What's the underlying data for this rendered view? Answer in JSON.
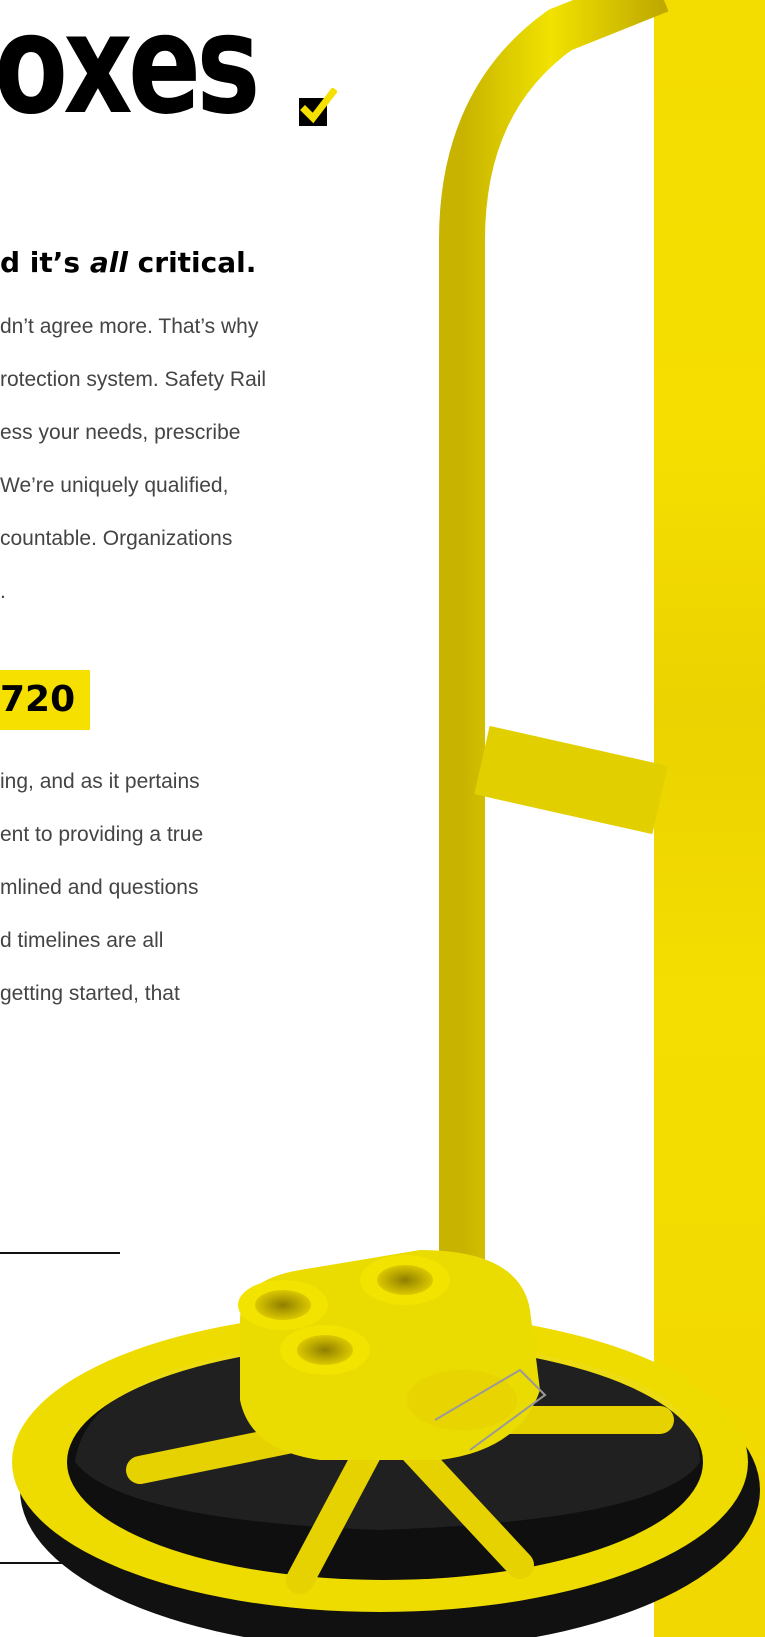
{
  "hero": {
    "title": "oxes"
  },
  "heading": {
    "prefix": "d it’s ",
    "emphasis": "all",
    "suffix": " critical."
  },
  "paragraph_1": [
    "dn’t agree more. That’s why",
    "rotection system. Safety Rail",
    "ess your needs, prescribe",
    "We’re uniquely qualified,",
    "countable. Organizations",
    "."
  ],
  "phone": {
    "partial": "720"
  },
  "paragraph_2": [
    "ing, and as it pertains",
    "ent to providing a true",
    "mlined and questions",
    "d timelines are all",
    "getting started, that"
  ],
  "colors": {
    "accent_yellow": "#f6e000",
    "text_dark": "#000000",
    "body_text": "#444444"
  },
  "icons": {
    "checkbox": "checkbox-check-icon"
  }
}
